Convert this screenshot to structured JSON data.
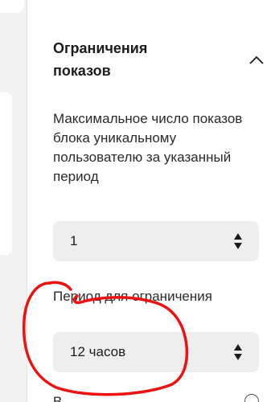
{
  "section": {
    "title": "Ограничения показов"
  },
  "fields": [
    {
      "label": "Максимальное число показов блока уникальному пользователю за указанный период",
      "value": "1"
    },
    {
      "label": "Период для ограничения",
      "value": "12 часов"
    }
  ],
  "next_field": {
    "label_start": "В"
  },
  "annotation": {
    "color": "#ee1111"
  },
  "icons": {
    "collapse": "chevron-up-icon",
    "stepper": "up-down-arrows-icon",
    "help": "question-circle-icon"
  }
}
